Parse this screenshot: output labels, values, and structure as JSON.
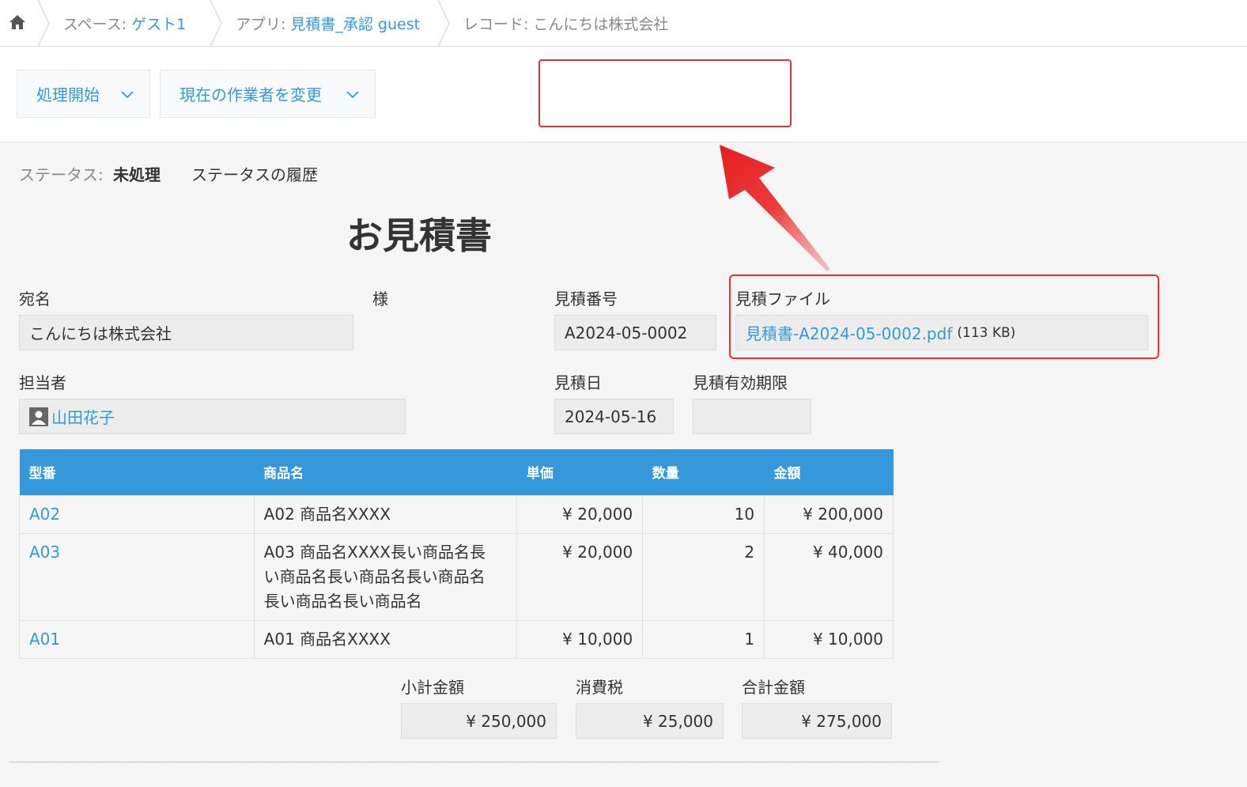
{
  "breadcrumb": {
    "space_label": "スペース:",
    "space_value": "ゲスト1",
    "app_label": "アプリ:",
    "app_value": "見積書_承認 guest",
    "record_label": "レコード:",
    "record_value": "こんにちは株式会社"
  },
  "toolbar": {
    "process_button": "処理開始",
    "change_assignee_button": "現在の作業者を変更"
  },
  "status": {
    "label": "ステータス:",
    "value": "未処理",
    "history_link": "ステータスの履歴"
  },
  "record": {
    "title": "お見積書",
    "addressee_label": "宛名",
    "addressee_value": "こんにちは株式会社",
    "honorific": "様",
    "quote_no_label": "見積番号",
    "quote_no_value": "A2024-05-0002",
    "file_label": "見積ファイル",
    "file_name": "見積書-A2024-05-0002.pdf",
    "file_size": "(113 KB)",
    "person_label": "担当者",
    "person_value": "山田花子",
    "date_label": "見積日",
    "date_value": "2024-05-16",
    "expiry_label": "見積有効期限",
    "expiry_value": ""
  },
  "table": {
    "headers": [
      "型番",
      "商品名",
      "単価",
      "数量",
      "金額"
    ],
    "rows": [
      {
        "code": "A02",
        "name": "A02 商品名XXXX",
        "price": "¥ 20,000",
        "qty": "10",
        "amount": "¥ 200,000"
      },
      {
        "code": "A03",
        "name_lines": [
          "A03 商品名XXXX長い商品名長",
          "い商品名長い商品名長い商品名",
          "長い商品名長い商品名"
        ],
        "price": "¥ 20,000",
        "qty": "2",
        "amount": "¥ 40,000"
      },
      {
        "code": "A01",
        "name": "A01 商品名XXXX",
        "price": "¥ 10,000",
        "qty": "1",
        "amount": "¥ 10,000"
      }
    ]
  },
  "totals": {
    "subtotal_label": "小計金額",
    "subtotal_value": "¥ 250,000",
    "tax_label": "消費税",
    "tax_value": "¥ 25,000",
    "total_label": "合計金額",
    "total_value": "¥ 275,000"
  },
  "colors": {
    "accent": "#3498db",
    "highlight": "#e8303a"
  }
}
